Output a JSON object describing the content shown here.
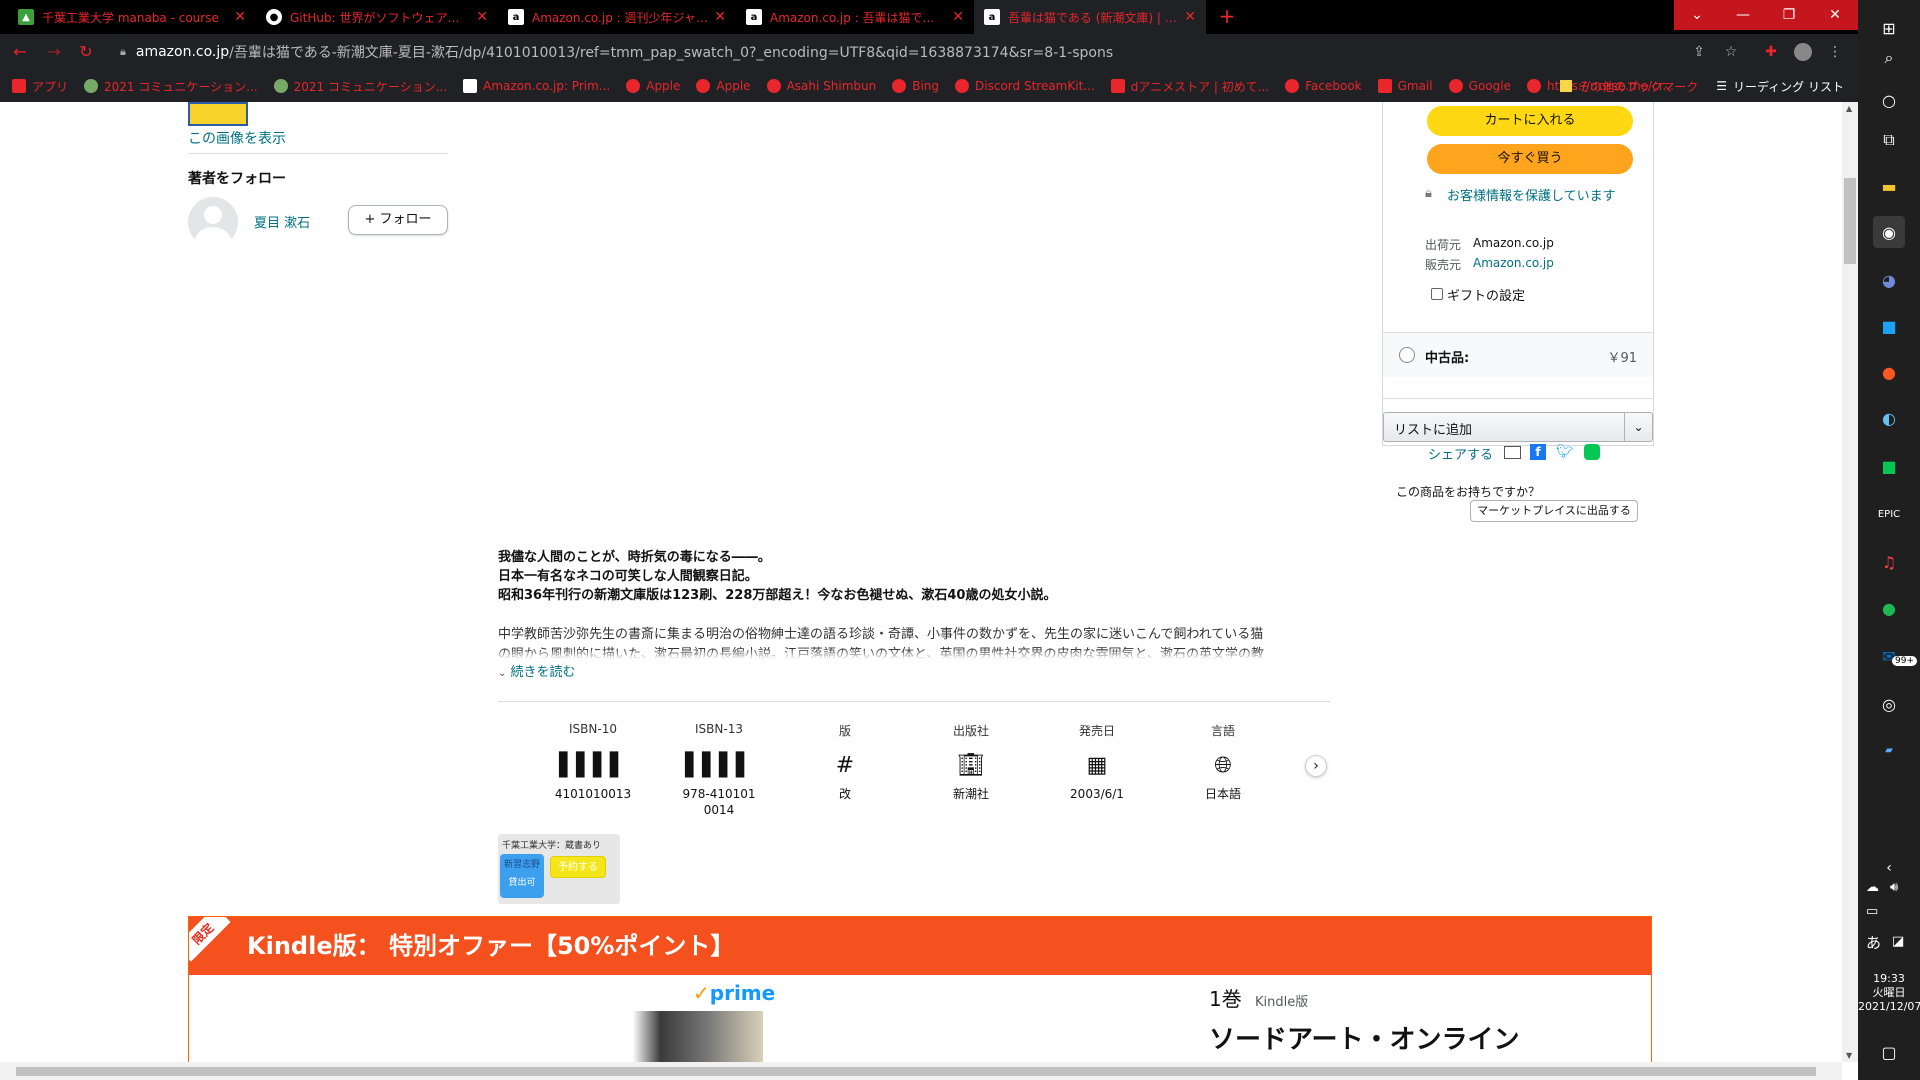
{
  "browser": {
    "tabs": [
      {
        "title": "千葉工業大学 manaba - course",
        "fav": "manaba"
      },
      {
        "title": "GitHub: 世界がソフトウェアを構築す",
        "fav": "github"
      },
      {
        "title": "Amazon.co.jp : 週刊少年ジャンプ",
        "fav": "amazon"
      },
      {
        "title": "Amazon.co.jp : 吾輩は猫である",
        "fav": "amazon"
      },
      {
        "title": "吾輩は猫である (新潮文庫) | 漱石,",
        "fav": "amazon"
      }
    ],
    "url_host": "amazon.co.jp",
    "url_path": "/吾輩は猫である-新潮文庫-夏目-漱石/dp/4101010013/ref=tmm_pap_swatch_0?_encoding=UTF8&qid=1638873174&sr=8-1-spons",
    "bookmarks": [
      "アプリ",
      "2021 コミュニケーション...",
      "2021 コミュニケーション...",
      "Amazon.co.jp: Prim...",
      "Apple",
      "Apple",
      "Asahi Shimbun",
      "Bing",
      "Discord StreamKit...",
      "dアニメストア | 初めて...",
      "Facebook",
      "Gmail",
      "Google",
      "https://ncase.me/cr..."
    ],
    "bookmarks_more": "»",
    "other_bookmarks": "その他のブックマーク",
    "reading_list": "リーディング リスト"
  },
  "left": {
    "show_image": "この画像を表示",
    "follow_heading": "著者をフォロー",
    "author": "夏目 漱石",
    "follow_btn": "+ フォロー"
  },
  "buybox": {
    "cart": "カートに入れる",
    "buy_now": "今すぐ買う",
    "secure": "お客様情報を保護しています",
    "ship_from_label": "出荷元",
    "ship_from": "Amazon.co.jp",
    "sold_by_label": "販売元",
    "sold_by": "Amazon.co.jp",
    "gift": "ギフトの設定",
    "used_label": "中古品:",
    "used_price": "￥91",
    "add_list": "リストに追加",
    "share": "シェアする",
    "have_q": "この商品をお持ちですか？",
    "sell_btn": "マーケットプレイスに出品する"
  },
  "description": {
    "bold1": "我儘な人間のことが、時折気の毒になる――。",
    "bold2": "日本一有名なネコの可笑しな人間観察日記。",
    "bold3": "昭和36年刊行の新潮文庫版は123刷、228万部超え！今なお色褪せぬ、漱石40歳の処女小説。",
    "p1": "中学教師苦沙弥先生の書斎に集まる明治の俗物紳士達の語る珍談・奇譚、小事件の数かずを、先生の家に迷いこんで飼われている猫",
    "p2": "の眼から風刺的に描いた、漱石最初の長編小説。江戸落語の笑いの文体と、英国の男性社交界の皮肉な雰囲気と、漱石の英文学の教",
    "read_more": "続きを読む"
  },
  "attributes": [
    {
      "label": "ISBN-10",
      "icon": "barcode-icon",
      "value": "4101010013"
    },
    {
      "label": "ISBN-13",
      "icon": "barcode-icon",
      "value": "978-4101010014"
    },
    {
      "label": "版",
      "icon": "hash-icon",
      "value": "改"
    },
    {
      "label": "出版社",
      "icon": "building-icon",
      "value": "新潮社"
    },
    {
      "label": "発売日",
      "icon": "calendar-icon",
      "value": "2003/6/1"
    },
    {
      "label": "言語",
      "icon": "globe-icon",
      "value": "日本語"
    }
  ],
  "library": {
    "title": "千葉工業大学：蔵書あり",
    "btn1": "新習志野",
    "btn1b": "貸出可",
    "btn2": "予約する"
  },
  "kindle": {
    "ribbon": "限定",
    "header": "Kindle版： 特別オファー【50%ポイント】",
    "prime": "prime",
    "volume": "1巻",
    "format": "Kindle版",
    "title": "ソードアート・オンライン"
  },
  "taskbar": {
    "time": "19:33",
    "day": "火曜日",
    "date": "2021/12/07",
    "badge": "99+",
    "ime": "あ"
  }
}
